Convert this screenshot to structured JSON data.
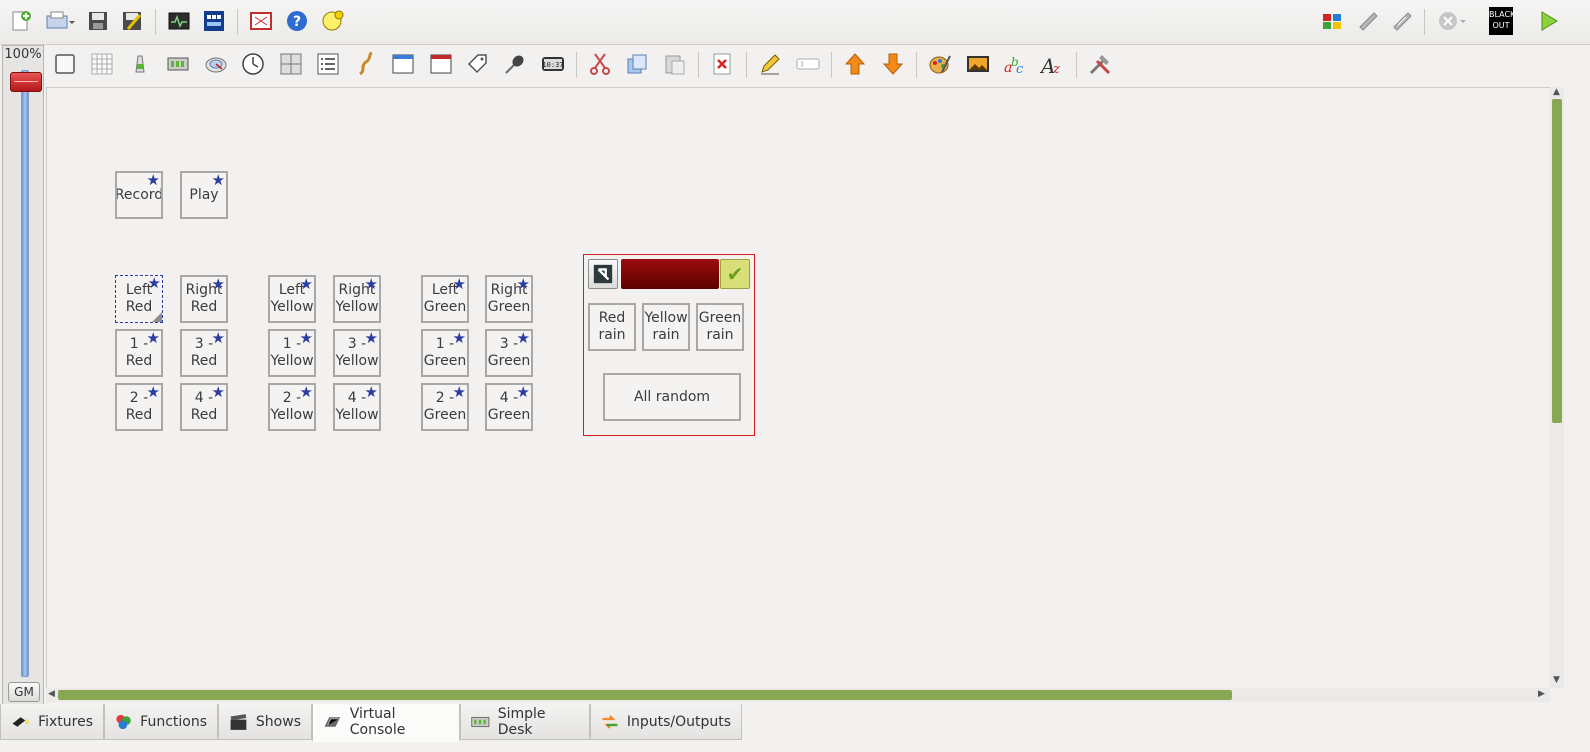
{
  "toolbar": {
    "left_icons": [
      "new-workspace-icon",
      "open-workspace-icon",
      "save-icon",
      "save-as-icon",
      "live-monitor-icon",
      "dmx-address-tool-icon",
      "fullscreen-icon",
      "help-icon",
      "about-icon"
    ],
    "right_icons": [
      "fixture-remap-icon",
      "dump-dmx-icon",
      "address-tool-icon",
      "stop-all-functions-icon",
      "blackout-icon",
      "operate-mode-icon"
    ],
    "blackout_label": "BLACK\nOUT"
  },
  "vc_toolbar": {
    "icons": [
      "add-button-icon",
      "add-button-matrix-icon",
      "add-slider-icon",
      "add-slider-matrix-icon",
      "add-knob-icon",
      "add-speed-dial-icon",
      "add-xy-pad-icon",
      "add-cue-list-icon",
      "add-frame-icon",
      "add-solo-frame-icon",
      "add-label-icon",
      "add-audio-triggers-icon",
      "add-clock-icon",
      "cut-icon",
      "copy-icon",
      "paste-icon",
      "delete-icon",
      "edit-properties-icon",
      "rename-icon",
      "bring-forward-icon",
      "send-backward-icon",
      "background-color-icon",
      "background-image-icon",
      "foreground-color-icon",
      "font-icon",
      "vc-settings-icon"
    ]
  },
  "grand_master": {
    "percent": "100%",
    "label": "GM",
    "level": 1.0
  },
  "canvas": {
    "buttons": [
      {
        "name": "record",
        "label": "Record"
      },
      {
        "name": "play",
        "label": "Play"
      },
      {
        "name": "left-red",
        "label": "Left\nRed",
        "selected": true
      },
      {
        "name": "right-red",
        "label": "Right\nRed"
      },
      {
        "name": "1-red",
        "label": "1 - Red"
      },
      {
        "name": "3-red",
        "label": "3 - Red"
      },
      {
        "name": "2-red",
        "label": "2 - Red"
      },
      {
        "name": "4-red",
        "label": "4 - Red"
      },
      {
        "name": "left-yellow",
        "label": "Left\nYellow"
      },
      {
        "name": "right-yellow",
        "label": "Right\nYellow"
      },
      {
        "name": "1-yellow",
        "label": "1 -\nYellow"
      },
      {
        "name": "3-yellow",
        "label": "3 -\nYellow"
      },
      {
        "name": "2-yellow",
        "label": "2 -\nYellow"
      },
      {
        "name": "4-yellow",
        "label": "4 -\nYellow"
      },
      {
        "name": "left-green",
        "label": "Left\nGreen"
      },
      {
        "name": "right-green",
        "label": "Right\nGreen"
      },
      {
        "name": "1-green",
        "label": "1 -\nGreen"
      },
      {
        "name": "3-green",
        "label": "3 -\nGreen"
      },
      {
        "name": "2-green",
        "label": "2 -\nGreen"
      },
      {
        "name": "4-green",
        "label": "4 -\nGreen"
      }
    ],
    "frame": {
      "header_color": "#7a0404",
      "buttons": [
        "Red\nrain",
        "Yellow\nrain",
        "Green\nrain"
      ],
      "all_random": "All random"
    }
  },
  "tabs": [
    {
      "label": "Fixtures",
      "icon": "fixtures-icon"
    },
    {
      "label": "Functions",
      "icon": "functions-icon"
    },
    {
      "label": "Shows",
      "icon": "shows-icon"
    },
    {
      "label": "Virtual Console",
      "icon": "virtual-console-icon",
      "active": true
    },
    {
      "label": "Simple Desk",
      "icon": "simple-desk-icon"
    },
    {
      "label": "Inputs/Outputs",
      "icon": "inputs-outputs-icon"
    }
  ],
  "colors": {
    "accent_selection": "#2b3ea0",
    "scrollbar": "#87a752",
    "frame_border": "#d71c1c"
  }
}
